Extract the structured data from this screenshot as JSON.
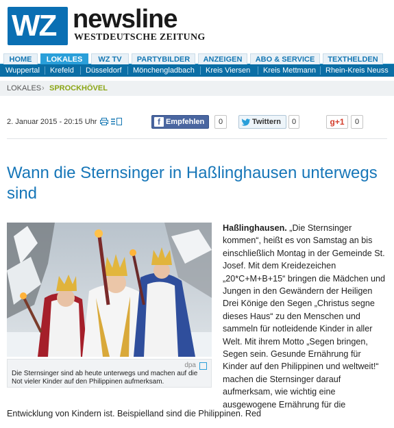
{
  "header": {
    "logo_text": "WZ",
    "brand": "newsline",
    "brand_sub": "WESTDEUTSCHE ZEITUNG"
  },
  "main_nav": [
    {
      "label": "HOME",
      "active": false
    },
    {
      "label": "LOKALES",
      "active": true
    },
    {
      "label": "WZ TV",
      "active": false
    },
    {
      "label": "PARTYBILDER",
      "active": false
    },
    {
      "label": "ANZEIGEN",
      "active": false
    },
    {
      "label": "ABO & SERVICE",
      "active": false
    },
    {
      "label": "TEXTHELDEN",
      "active": false
    }
  ],
  "sub_nav": [
    "Wuppertal",
    "Krefeld",
    "Düsseldorf",
    "Mönchengladbach",
    "Kreis Viersen",
    "Kreis Mettmann",
    "Rhein-Kreis Neuss"
  ],
  "breadcrumb": {
    "level1": "LOKALES",
    "separator": "›",
    "level2": "SPROCKHÖVEL"
  },
  "meta": {
    "date": "2. Januar 2015 - 20:15 Uhr",
    "print_icon": "print-icon",
    "list_icon": "list-icon"
  },
  "social": {
    "facebook_label": "Empfehlen",
    "facebook_count": "0",
    "twitter_label": "Twittern",
    "twitter_count": "0",
    "gplus_label": "g+1",
    "gplus_count": "0"
  },
  "article": {
    "headline": "Wann die Sternsinger in Haßlinghausen unterwegs sind",
    "dateline": "Haßlinghausen.",
    "body_column": "„Die Sternsinger kommen“, heißt es von Samstag an bis einschließlich Montag in der Gemeinde St. Josef. Mit dem Kreidezeichen „20*C+M+B+15“ bringen die Mädchen und Jungen in den Gewändern der Heiligen Drei Könige den Segen „Christus segne dieses Haus“ zu den Menschen und sammeln für notleidende Kinder in aller Welt. Mit ihrem Motto „Segen bringen, Segen sein. Gesunde Ernährung für Kinder auf den Philippinen und weltweit!“ machen die Sternsinger darauf aufmerksam, wie wichtig eine ausgewogene Ernährung für die",
    "body_tail": "Entwicklung von Kindern ist. Beispielland sind die Philippinen. Red",
    "image_credit": "dpa",
    "image_caption": "Die Sternsinger sind ab heute unterwegs und machen auf die Not vieler Kinder auf den Philippinen aufmerksam."
  },
  "colors": {
    "brand_blue": "#0a6fb3",
    "nav_active": "#2a9fd9",
    "subnav_bg": "#0b6ea5",
    "headline": "#1676b8",
    "breadcrumb_accent": "#8aa514"
  }
}
